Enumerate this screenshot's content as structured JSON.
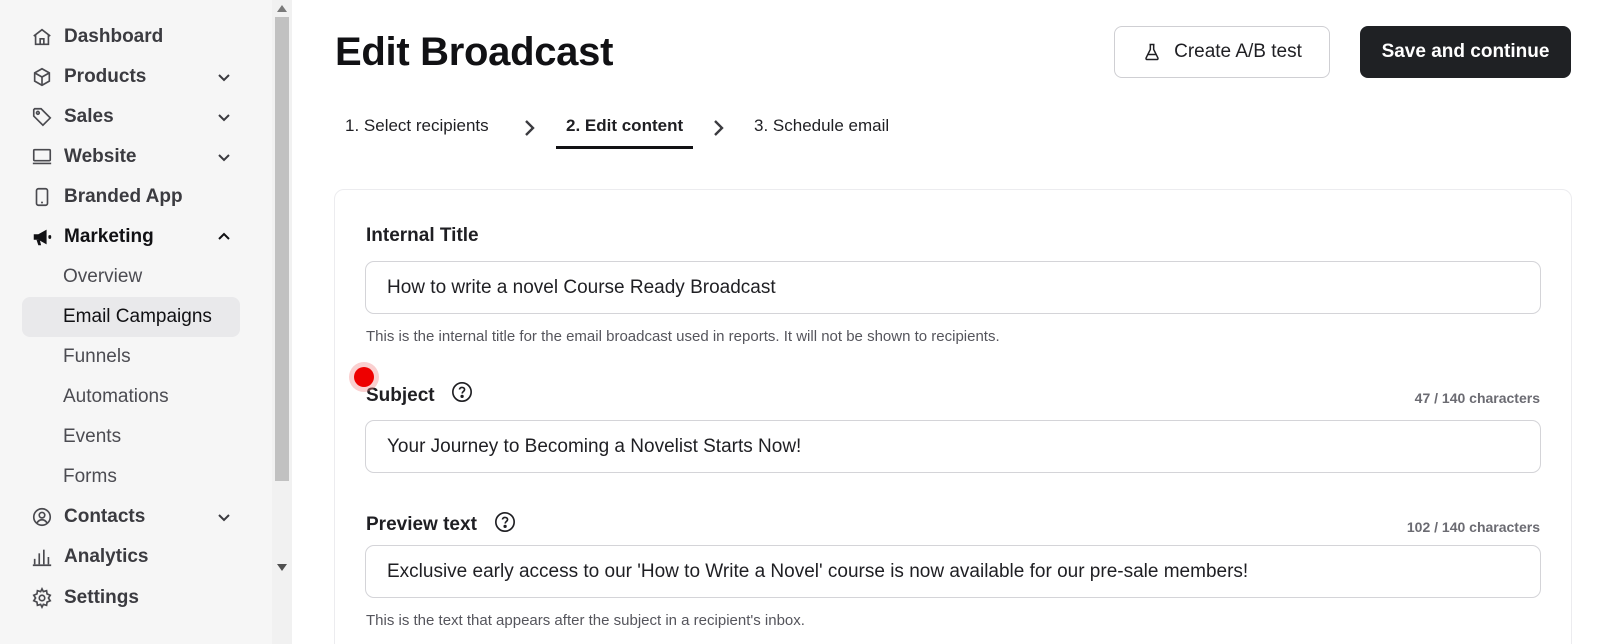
{
  "sidebar": {
    "items": [
      {
        "label": "Dashboard",
        "icon": "home-icon"
      },
      {
        "label": "Products",
        "icon": "box-icon"
      },
      {
        "label": "Sales",
        "icon": "tag-icon"
      },
      {
        "label": "Website",
        "icon": "monitor-icon"
      },
      {
        "label": "Branded App",
        "icon": "phone-icon"
      },
      {
        "label": "Marketing",
        "icon": "megaphone-icon"
      },
      {
        "label": "Contacts",
        "icon": "user-circle-icon"
      },
      {
        "label": "Analytics",
        "icon": "bar-chart-icon"
      },
      {
        "label": "Settings",
        "icon": "gear-icon"
      }
    ],
    "marketing_sub": [
      "Overview",
      "Email Campaigns",
      "Funnels",
      "Automations",
      "Events",
      "Forms"
    ],
    "active_sub": "Email Campaigns"
  },
  "header": {
    "title": "Edit Broadcast",
    "ab_button": "Create A/B test",
    "save_button": "Save and continue"
  },
  "steps": [
    "1. Select recipients",
    "2. Edit content",
    "3. Schedule email"
  ],
  "active_step": 1,
  "form": {
    "internal_title": {
      "label": "Internal Title",
      "value": "How to write a novel Course Ready Broadcast",
      "hint": "This is the internal title for the email broadcast used in reports. It will not be shown to recipients."
    },
    "subject": {
      "label": "Subject",
      "counter": "47 / 140 characters",
      "value": "Your Journey to Becoming a Novelist Starts Now!"
    },
    "preview_text": {
      "label": "Preview text",
      "counter": "102 / 140 characters",
      "value": "Exclusive early access to our 'How to Write a Novel' course is now available for our pre-sale members!",
      "hint": "This is the text that appears after the subject in a recipient's inbox."
    }
  },
  "colors": {
    "primary_button": "#1f2124",
    "sidebar_bg": "#f6f6f6",
    "active_item_bg": "#e9e9eb",
    "cursor_marker": "#ee0000"
  }
}
